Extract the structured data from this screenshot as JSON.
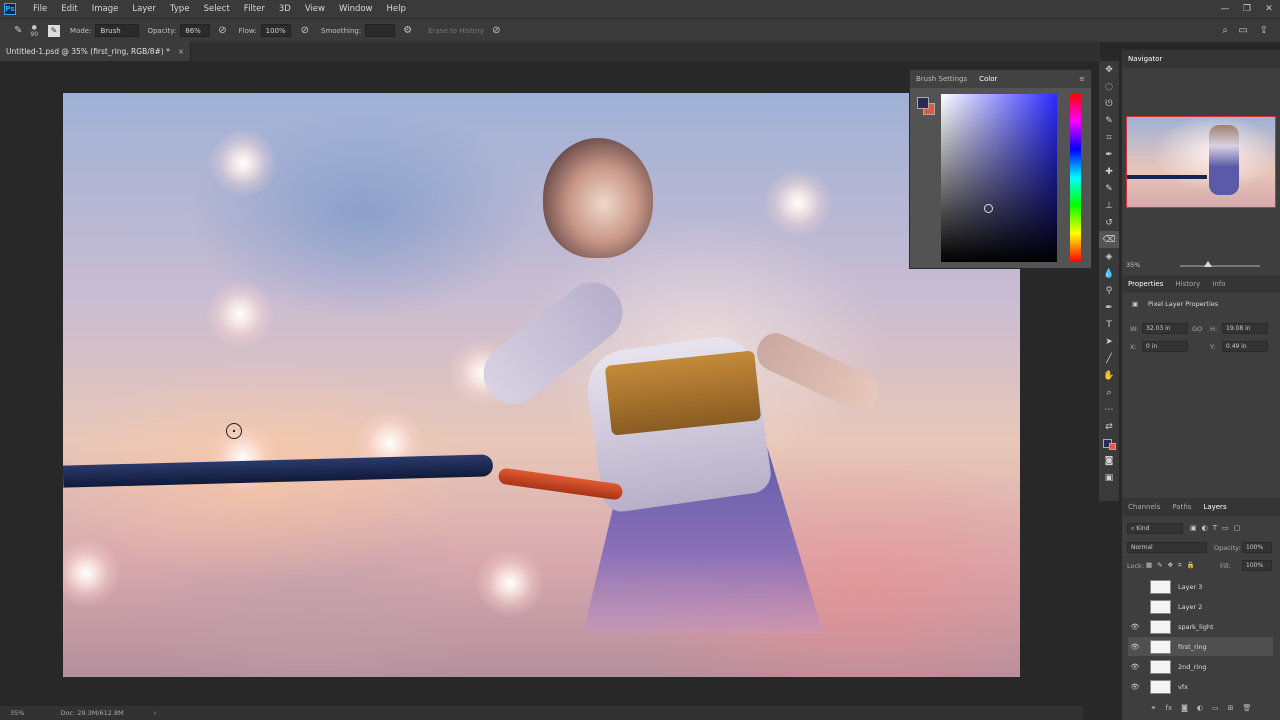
{
  "menubar": {
    "logo": "Ps",
    "items": [
      "File",
      "Edit",
      "Image",
      "Layer",
      "Type",
      "Select",
      "Filter",
      "3D",
      "View",
      "Window",
      "Help"
    ]
  },
  "options": {
    "mode_label": "Mode:",
    "mode_value": "Brush",
    "opacity_label": "Opacity:",
    "opacity_value": "86%",
    "flow_label": "Flow:",
    "flow_value": "100%",
    "smoothing_label": "Smoothing:",
    "erase_history_label": "Erase to History",
    "brush_size": "90"
  },
  "document": {
    "tab_title": "Untitled-1.psd @ 35% (first_ring, RGB/8#) *",
    "tab_close": "×"
  },
  "color_panel": {
    "tabs": [
      "Brush Settings",
      "Color"
    ],
    "active_tab": "Color",
    "foreground": "#2a2a58",
    "background": "#e05a40"
  },
  "navigator": {
    "title": "Navigator",
    "zoom": "35%"
  },
  "properties": {
    "tabs": [
      "Properties",
      "History",
      "Info"
    ],
    "heading": "Pixel Layer Properties",
    "w_label": "W:",
    "w_value": "32.03 in",
    "link": "GO",
    "h_label": "H:",
    "h_value": "19.08 in",
    "x_label": "X:",
    "x_value": "0 in",
    "y_label": "Y:",
    "y_value": "0.49 in"
  },
  "layers_panel": {
    "tabs": [
      "Channels",
      "Paths",
      "Layers"
    ],
    "kind_label": "Kind",
    "blend_mode": "Normal",
    "opacity_label": "Opacity:",
    "opacity_value": "100%",
    "lock_label": "Lock:",
    "fill_label": "Fill:",
    "fill_value": "100%",
    "layers": [
      {
        "name": "Layer 3",
        "visible": false,
        "selected": false
      },
      {
        "name": "Layer 2",
        "visible": false,
        "selected": false
      },
      {
        "name": "spark_light",
        "visible": true,
        "selected": false
      },
      {
        "name": "first_ring",
        "visible": true,
        "selected": true
      },
      {
        "name": "2nd_ring",
        "visible": true,
        "selected": false
      },
      {
        "name": "vfx",
        "visible": true,
        "selected": false
      }
    ]
  },
  "status": {
    "zoom": "35%",
    "doc": "Doc: 29.3M/612.8M"
  }
}
